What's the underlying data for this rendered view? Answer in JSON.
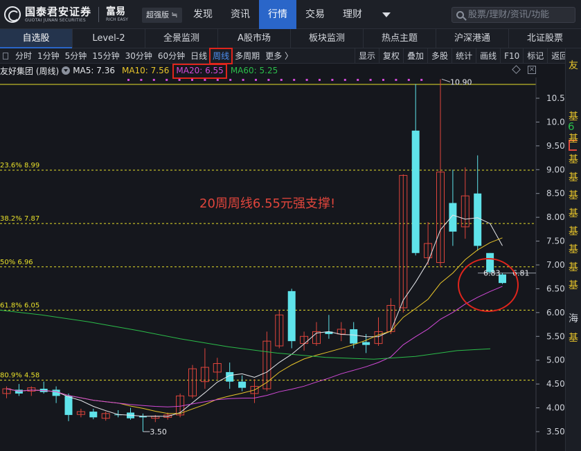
{
  "topbar": {
    "logo_cn": "国泰君安证券",
    "logo_en": "GUOTAI JUNAN SECURITIES",
    "app_cn": "富易",
    "app_en": "RICH EASY",
    "edition": "超强版 ≒",
    "nav": [
      "发现",
      "资讯",
      "行情",
      "交易",
      "理财"
    ],
    "nav_active": "行情",
    "search_placeholder": "股票/理财/资讯/功能"
  },
  "module_tabs": [
    "自选股",
    "Level-2",
    "全景监测",
    "A股市场",
    "板块监测",
    "热点主题",
    "沪深港通",
    "北证股票"
  ],
  "module_active": "自选股",
  "periods": [
    "分时",
    "1分钟",
    "5分钟",
    "15分钟",
    "30分钟",
    "60分钟",
    "日线",
    "周线",
    "多周期",
    "更多 〉"
  ],
  "period_active": "周线",
  "tools": [
    "显示",
    "复权",
    "叠加",
    "多股",
    "统计",
    "画线",
    "F10",
    "标记",
    "返回"
  ],
  "indicator": {
    "stock_name": "友好集团 (周线)",
    "ma5": "MA5: 7.36",
    "ma10": "MA10: 7.56",
    "ma20": "MA20: 6.55",
    "ma60": "MA60: 5.25"
  },
  "colors": {
    "up": "#e0453c",
    "down": "#5fe3ea",
    "ma5": "#e6e8ec",
    "ma10": "#e8c52a",
    "ma20": "#d24ad8",
    "ma60": "#2bbd4a",
    "fib": "#e8e02a",
    "annotation": "#e0453c",
    "highlight_box": "#e0251c"
  },
  "right_panel": {
    "chars": [
      "友",
      "基",
      "基",
      "基",
      "基",
      "基",
      "基",
      "基",
      "基",
      "基",
      "基",
      "海",
      "基"
    ],
    "price": "6"
  },
  "chart_data": {
    "type": "candlestick",
    "title": "",
    "y_axis_labels": [
      "10.50",
      "10.00",
      "9.50",
      "9.00",
      "8.50",
      "8.00",
      "7.50",
      "7.00",
      "6.50",
      "6.00",
      "5.50",
      "5.00",
      "4.50",
      "4.00",
      "3.50"
    ],
    "ylim": [
      3.3,
      10.9
    ],
    "fib_levels": [
      {
        "label": "23.6% 8.99",
        "value": 8.99
      },
      {
        "label": "38.2% 7.87",
        "value": 7.87
      },
      {
        "label": "50% 6.96",
        "value": 6.96
      },
      {
        "label": "61.8% 6.05",
        "value": 6.05
      },
      {
        "label": "80.9% 4.58",
        "value": 4.58
      }
    ],
    "annotations": {
      "high_label": "10.90",
      "low_label": "3.50",
      "last_label_a": "6.83",
      "last_label_b": "6.81",
      "callout": "20周周线6.55元强支撑!"
    },
    "candles": [
      {
        "o": 4.3,
        "h": 4.45,
        "l": 4.2,
        "c": 4.4
      },
      {
        "o": 4.38,
        "h": 4.5,
        "l": 4.25,
        "c": 4.3
      },
      {
        "o": 4.35,
        "h": 4.45,
        "l": 4.25,
        "c": 4.42
      },
      {
        "o": 4.4,
        "h": 4.55,
        "l": 4.3,
        "c": 4.33
      },
      {
        "o": 4.38,
        "h": 4.45,
        "l": 4.1,
        "c": 4.25
      },
      {
        "o": 4.25,
        "h": 4.3,
        "l": 3.72,
        "c": 3.85
      },
      {
        "o": 3.86,
        "h": 3.98,
        "l": 3.8,
        "c": 3.92
      },
      {
        "o": 3.92,
        "h": 3.98,
        "l": 3.76,
        "c": 3.8
      },
      {
        "o": 3.78,
        "h": 3.92,
        "l": 3.73,
        "c": 3.88
      },
      {
        "o": 3.86,
        "h": 3.95,
        "l": 3.8,
        "c": 3.85
      },
      {
        "o": 3.9,
        "h": 4.0,
        "l": 3.75,
        "c": 3.78
      },
      {
        "o": 3.82,
        "h": 3.88,
        "l": 3.5,
        "c": 3.8
      },
      {
        "o": 3.78,
        "h": 3.85,
        "l": 3.7,
        "c": 3.82
      },
      {
        "o": 3.8,
        "h": 3.9,
        "l": 3.75,
        "c": 3.85
      },
      {
        "o": 3.85,
        "h": 4.3,
        "l": 3.8,
        "c": 4.25
      },
      {
        "o": 4.25,
        "h": 4.9,
        "l": 4.2,
        "c": 4.82
      },
      {
        "o": 4.55,
        "h": 5.25,
        "l": 4.4,
        "c": 4.85
      },
      {
        "o": 4.75,
        "h": 5.05,
        "l": 4.6,
        "c": 4.93
      },
      {
        "o": 4.75,
        "h": 4.95,
        "l": 4.4,
        "c": 4.55
      },
      {
        "o": 4.55,
        "h": 4.68,
        "l": 4.35,
        "c": 4.42
      },
      {
        "o": 4.3,
        "h": 4.6,
        "l": 4.1,
        "c": 4.45
      },
      {
        "o": 4.4,
        "h": 5.6,
        "l": 4.35,
        "c": 5.4
      },
      {
        "o": 5.3,
        "h": 6.05,
        "l": 5.25,
        "c": 5.95
      },
      {
        "o": 6.45,
        "h": 6.5,
        "l": 5.25,
        "c": 5.4
      },
      {
        "o": 5.35,
        "h": 5.6,
        "l": 5.2,
        "c": 5.5
      },
      {
        "o": 5.35,
        "h": 5.8,
        "l": 5.3,
        "c": 5.6
      },
      {
        "o": 5.6,
        "h": 5.95,
        "l": 5.45,
        "c": 5.55
      },
      {
        "o": 5.55,
        "h": 5.8,
        "l": 5.4,
        "c": 5.65
      },
      {
        "o": 5.65,
        "h": 5.8,
        "l": 5.25,
        "c": 5.35
      },
      {
        "o": 5.38,
        "h": 5.55,
        "l": 5.15,
        "c": 5.32
      },
      {
        "o": 5.35,
        "h": 5.9,
        "l": 5.3,
        "c": 5.6
      },
      {
        "o": 5.6,
        "h": 6.3,
        "l": 5.55,
        "c": 6.15
      },
      {
        "o": 6.1,
        "h": 8.9,
        "l": 6.0,
        "c": 8.88
      },
      {
        "o": 9.82,
        "h": 10.8,
        "l": 7.2,
        "c": 7.25
      },
      {
        "o": 7.15,
        "h": 7.9,
        "l": 7.0,
        "c": 7.45
      },
      {
        "o": 7.05,
        "h": 10.9,
        "l": 6.95,
        "c": 8.95
      },
      {
        "o": 8.3,
        "h": 9.0,
        "l": 7.4,
        "c": 7.7
      },
      {
        "o": 7.8,
        "h": 9.05,
        "l": 7.55,
        "c": 8.45
      },
      {
        "o": 8.5,
        "h": 9.3,
        "l": 7.3,
        "c": 7.4
      },
      {
        "o": 7.25,
        "h": 7.25,
        "l": 6.82,
        "c": 6.85
      },
      {
        "o": 6.8,
        "h": 6.83,
        "l": 6.6,
        "c": 6.62
      }
    ]
  }
}
